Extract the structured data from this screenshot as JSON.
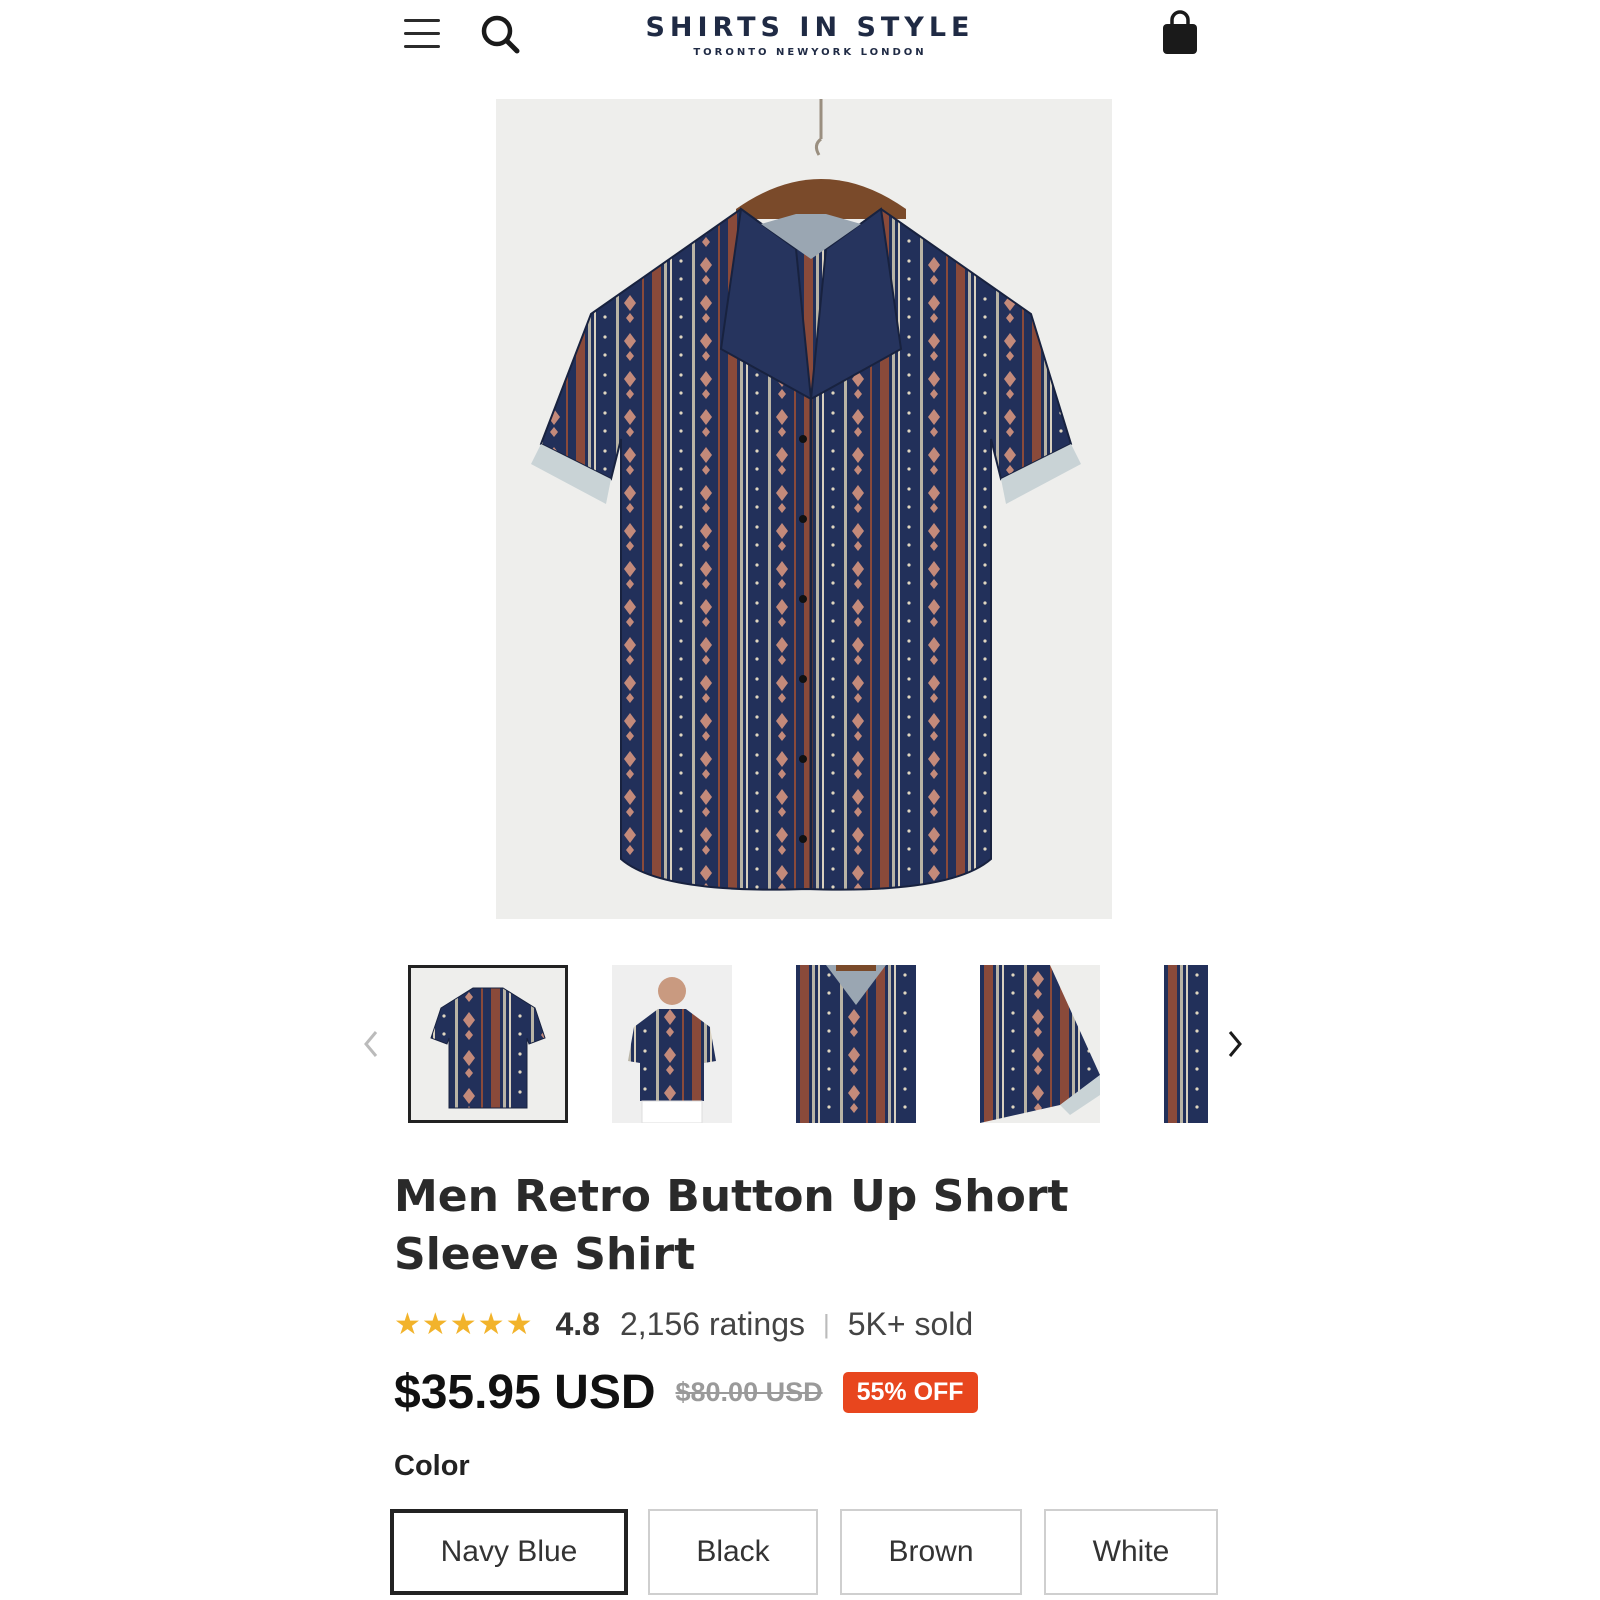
{
  "header": {
    "brand_name": "SHIRTS IN STYLE",
    "brand_tagline": "TORONTO NEWYORK LONDON",
    "menu_icon": "hamburger-menu-icon",
    "search_icon": "search-icon",
    "cart_icon": "shopping-bag-icon"
  },
  "product": {
    "title": "Men Retro Button Up Short Sleeve Shirt",
    "rating": {
      "stars": 5,
      "value": "4.8",
      "count": "2,156 ratings",
      "sold": "5K+ sold"
    },
    "price": "$35.95 USD",
    "original_price": "$80.00 USD",
    "discount": "55% OFF",
    "color_label": "Color",
    "colors": [
      "Navy Blue",
      "Black",
      "Brown",
      "White"
    ],
    "selected_color": "Navy Blue"
  },
  "gallery": {
    "selected_index": 0,
    "thumbnails": [
      "shirt-front",
      "model-wearing",
      "collar-detail",
      "sleeve-detail",
      "fabric-detail"
    ]
  },
  "colors": {
    "navy": "#1f2b4d",
    "stripe_rust": "#8a4a3a",
    "star": "#f2b32b",
    "discount_badge": "#e8461e"
  }
}
